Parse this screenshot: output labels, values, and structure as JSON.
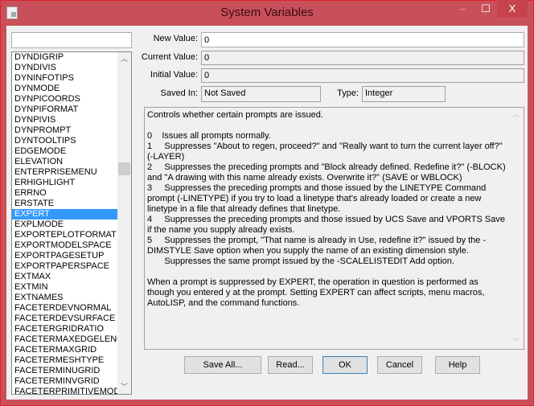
{
  "window": {
    "title": "System Variables",
    "minimize": "‒",
    "maximize": "☐",
    "close": "X",
    "title_color": "#c9505a"
  },
  "search": {
    "value": ""
  },
  "list": {
    "items": [
      "DYNDIGRIP",
      "DYNDIVIS",
      "DYNINFOTIPS",
      "DYNMODE",
      "DYNPICOORDS",
      "DYNPIFORMAT",
      "DYNPIVIS",
      "DYNPROMPT",
      "DYNTOOLTIPS",
      "EDGEMODE",
      "ELEVATION",
      "ENTERPRISEMENU",
      "ERHIGHLIGHT",
      "ERRNO",
      "ERSTATE",
      "EXPERT",
      "EXPLMODE",
      "EXPORTEPLOTFORMAT",
      "EXPORTMODELSPACE",
      "EXPORTPAGESETUP",
      "EXPORTPAPERSPACE",
      "EXTMAX",
      "EXTMIN",
      "EXTNAMES",
      "FACETERDEVNORMAL",
      "FACETERDEVSURFACE",
      "FACETERGRIDRATIO",
      "FACETERMAXEDGELENGTH",
      "FACETERMAXGRID",
      "FACETERMESHTYPE",
      "FACETERMINUGRID",
      "FACETERMINVGRID",
      "FACETERPRIMITIVEMODE"
    ],
    "selected": "EXPERT"
  },
  "fields": {
    "new_value": {
      "label": "New Value:",
      "value": "0"
    },
    "current_value": {
      "label": "Current Value:",
      "value": "0"
    },
    "initial_value": {
      "label": "Initial Value:",
      "value": "0"
    },
    "saved_in": {
      "label": "Saved In:",
      "value": "Not Saved"
    },
    "type": {
      "label": "Type:",
      "value": "Integer"
    }
  },
  "help_text": "Controls whether certain prompts are issued.\n\n0    Issues all prompts normally.\n1     Suppresses \"About to regen, proceed?\" and \"Really want to turn the current layer off?\" (-LAYER)\n2     Suppresses the preceding prompts and \"Block already defined. Redefine it?\" (-BLOCK) and \"A drawing with this name already exists. Overwrite it?\" (SAVE or WBLOCK)\n3     Suppresses the preceding prompts and those issued by the LINETYPE Command prompt (-LINETYPE) if you try to load a linetype that's already loaded or create a new linetype in a file that already defines that linetype.\n4     Suppresses the preceding prompts and those issued by UCS Save and VPORTS Save if the name you supply already exists.\n5     Suppresses the prompt, \"That name is already in Use, redefine it?\" issued by the -DIMSTYLE Save option when you supply the name of an existing dimension style.\n       Suppresses the same prompt issued by the -SCALELISTEDIT Add option.\n\nWhen a prompt is suppressed by EXPERT, the operation in question is performed as though you entered y at the prompt. Setting EXPERT can affect scripts, menu macros, AutoLISP, and the command functions.",
  "buttons": {
    "save_all": "Save All...",
    "read": "Read...",
    "ok": "OK",
    "cancel": "Cancel",
    "help": "Help"
  }
}
